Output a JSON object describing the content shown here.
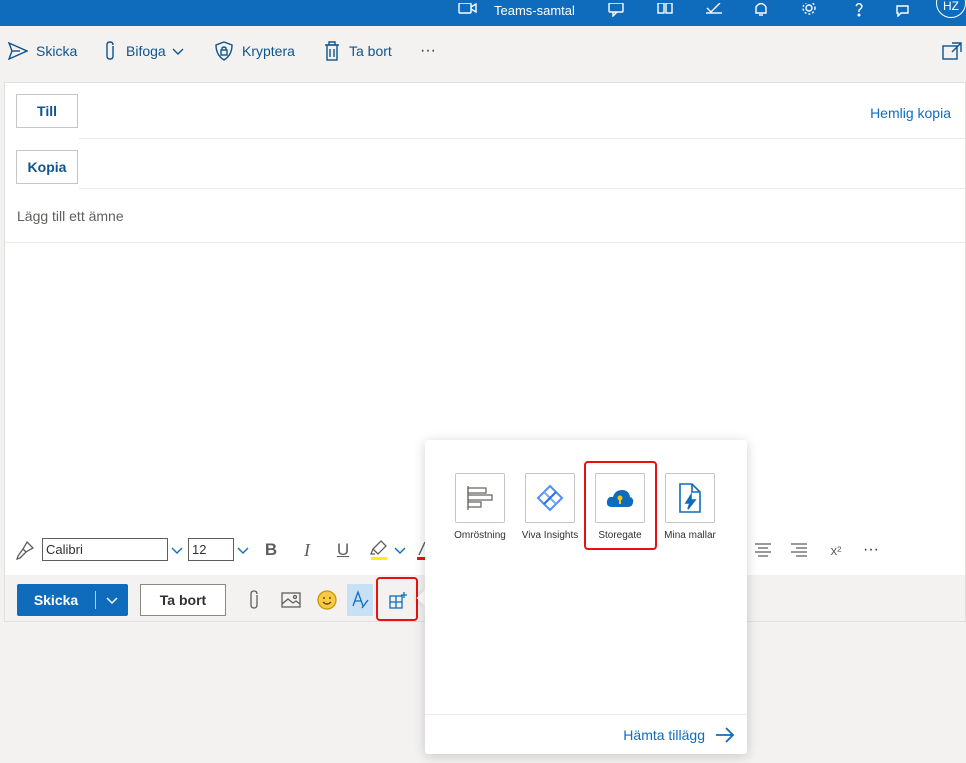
{
  "topbar": {
    "teams_label": "Teams-samtal",
    "avatar_initials": "HZ"
  },
  "commandbar": {
    "send": "Skicka",
    "attach": "Bifoga",
    "encrypt": "Kryptera",
    "delete": "Ta bort",
    "more": "···"
  },
  "compose": {
    "to_label": "Till",
    "cc_label": "Kopia",
    "bcc_label": "Hemlig kopia",
    "subject_placeholder": "Lägg till ett ämne"
  },
  "format": {
    "font_name": "Calibri",
    "font_size": "12",
    "bold": "B",
    "italic": "I",
    "underline": "U",
    "superscript": "x²",
    "more": "···"
  },
  "actions": {
    "send": "Skicka",
    "discard": "Ta bort"
  },
  "addins_popup": {
    "items": [
      {
        "name": "Omröstning",
        "icon": "poll-icon"
      },
      {
        "name": "Viva Insights",
        "icon": "viva-insights-icon"
      },
      {
        "name": "Storegate",
        "icon": "storegate-cloud-icon"
      },
      {
        "name": "Mina mallar",
        "icon": "templates-icon"
      }
    ],
    "get_addins": "Hämta tillägg"
  },
  "colors": {
    "brand": "#0f6cbd",
    "highlight": "#e8110f"
  }
}
